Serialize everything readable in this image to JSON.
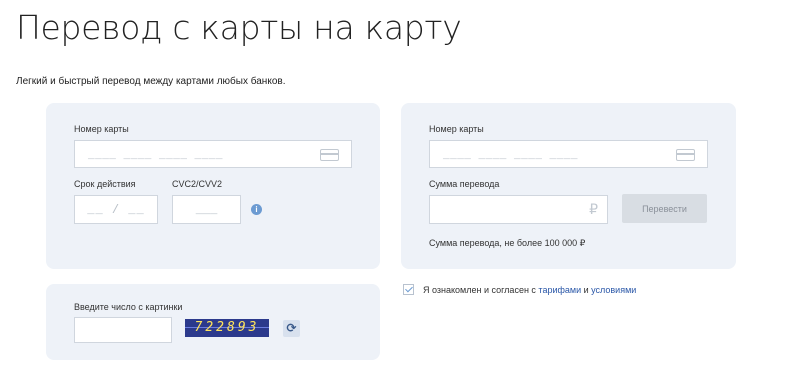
{
  "page": {
    "title": "Перевод с карты на карту",
    "subtitle": "Легкий и быстрый перевод между картами любых банков."
  },
  "from_card": {
    "card_number_label": "Номер карты",
    "card_number_placeholder": "____ ____ ____ ____",
    "expiry_label": "Срок действия",
    "expiry_placeholder": "__ / __",
    "cvc_label": "CVC2/CVV2",
    "cvc_placeholder": "___",
    "info_icon": "i"
  },
  "to_card": {
    "card_number_label": "Номер карты",
    "card_number_placeholder": "____ ____ ____ ____",
    "amount_label": "Сумма перевода",
    "currency_symbol": "₽",
    "transfer_button": "Перевести",
    "amount_limit_note": "Сумма перевода, не более 100 000 ₽"
  },
  "captcha": {
    "label": "Введите число с картинки",
    "value": "",
    "image_text": "722893",
    "refresh_icon": "⟳"
  },
  "agreement": {
    "checked": true,
    "text_prefix": "Я ознакомлен и согласен с ",
    "link_tariffs": "тарифами",
    "text_and": " и ",
    "link_conditions": "условиями"
  },
  "colors": {
    "panel_bg": "#eef2f8",
    "accent": "#2a57a8",
    "info": "#6c9bd2",
    "button_disabled": "#d8dde3"
  }
}
